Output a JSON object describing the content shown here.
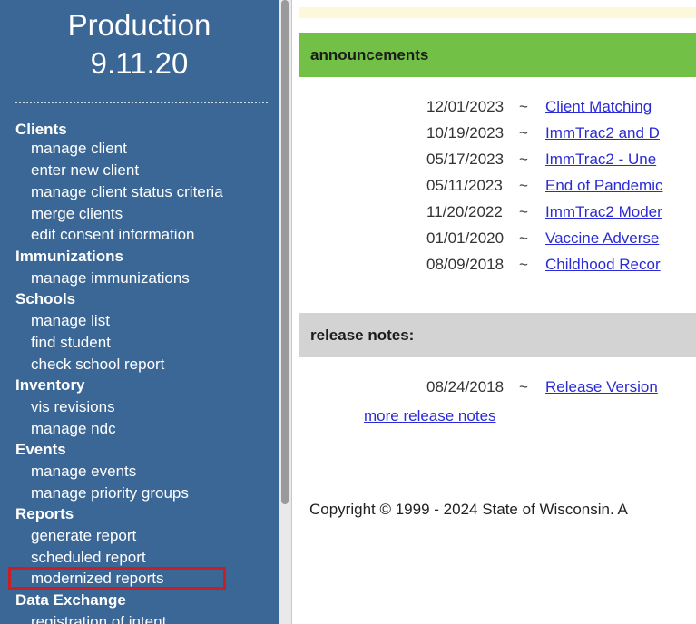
{
  "sidebar": {
    "title_line1": "Production",
    "title_line2": "9.11.20",
    "sections": [
      {
        "label": "Clients",
        "items": [
          "manage client",
          "enter new client",
          "manage client status criteria",
          "merge clients",
          "edit consent information"
        ]
      },
      {
        "label": "Immunizations",
        "items": [
          "manage immunizations"
        ]
      },
      {
        "label": "Schools",
        "items": [
          "manage list",
          "find student",
          "check school report"
        ]
      },
      {
        "label": "Inventory",
        "items": [
          "vis revisions",
          "manage ndc"
        ]
      },
      {
        "label": "Events",
        "items": [
          "manage events",
          "manage priority groups"
        ]
      },
      {
        "label": "Reports",
        "items": [
          "generate report",
          "scheduled report",
          "modernized reports"
        ]
      },
      {
        "label": "Data Exchange",
        "items": [
          "registration of intent"
        ]
      }
    ]
  },
  "announcements": {
    "header": "announcements",
    "rows": [
      {
        "date": "12/01/2023",
        "sep": "~",
        "link": "Client Matching"
      },
      {
        "date": "10/19/2023",
        "sep": "~",
        "link": "ImmTrac2 and D"
      },
      {
        "date": "05/17/2023",
        "sep": "~",
        "link": "ImmTrac2 - Une"
      },
      {
        "date": "05/11/2023",
        "sep": "~",
        "link": "End of Pandemic"
      },
      {
        "date": "11/20/2022",
        "sep": "~",
        "link": "ImmTrac2 Moder"
      },
      {
        "date": "01/01/2020",
        "sep": "~",
        "link": "Vaccine Adverse"
      },
      {
        "date": "08/09/2018",
        "sep": "~",
        "link": "Childhood Recor"
      }
    ]
  },
  "release_notes": {
    "header": "release notes:",
    "rows": [
      {
        "date": "08/24/2018",
        "sep": "~",
        "link": "Release Version"
      }
    ],
    "more_link": "more release notes"
  },
  "footer": {
    "copyright": "Copyright © 1999 - 2024 State of Wisconsin. A"
  },
  "colors": {
    "sidebar_bg": "#3a6796",
    "announcement_header": "#72c045",
    "release_header": "#d3d3d3",
    "link": "#2b2bd6",
    "highlight": "#c81e24"
  }
}
